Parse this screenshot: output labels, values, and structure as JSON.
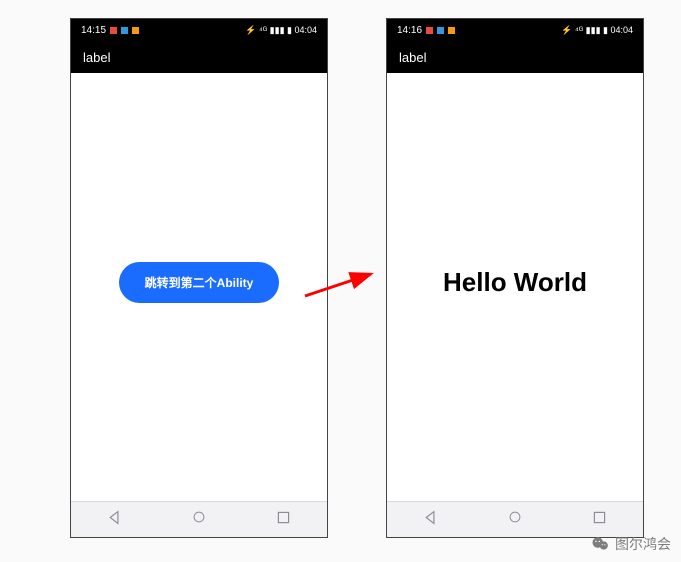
{
  "phones": {
    "left": {
      "time": "14:15",
      "status_right": "⚡ ⁴ᴳ ▮▮▮ ▮ 04:04",
      "title": "label",
      "button_label": "跳转到第二个Ability"
    },
    "right": {
      "time": "14:16",
      "status_right": "⚡ ⁴ᴳ ▮▮▮ ▮ 04:04",
      "title": "label",
      "main_text": "Hello World"
    }
  },
  "watermark": "图尔鸿会"
}
